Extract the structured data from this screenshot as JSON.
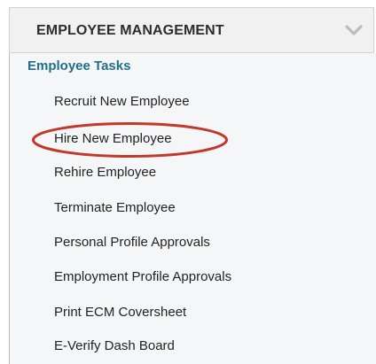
{
  "header": {
    "title": "EMPLOYEE MANAGEMENT",
    "toggle_icon": "chevron-down-icon"
  },
  "section": {
    "title": "Employee Tasks"
  },
  "items": [
    {
      "label": "Recruit New Employee"
    },
    {
      "label": "Hire New Employee"
    },
    {
      "label": "Rehire Employee"
    },
    {
      "label": "Terminate Employee"
    },
    {
      "label": "Personal Profile Approvals"
    },
    {
      "label": "Employment Profile Approvals"
    },
    {
      "label": "Print ECM Coversheet"
    },
    {
      "label": "E-Verify Dash Board"
    }
  ],
  "colors": {
    "section_title": "#1f6f8b",
    "highlight_ellipse": "#c0392b",
    "header_bg": "#f1f1f1"
  }
}
